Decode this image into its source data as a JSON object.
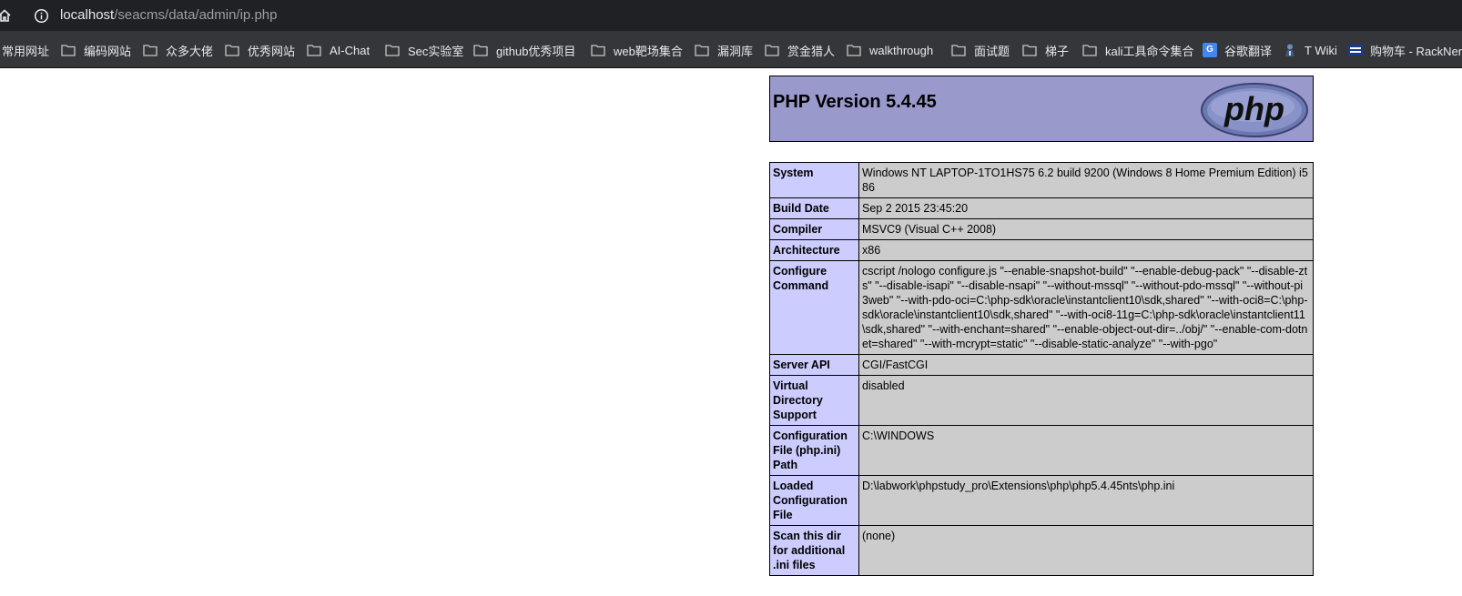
{
  "browser": {
    "url_host": "localhost",
    "url_path": "/seacms/data/admin/ip.php",
    "bookmarks": [
      {
        "label": "常用网址",
        "icon": "folder-icon"
      },
      {
        "label": "编码网站",
        "icon": "folder-icon"
      },
      {
        "label": "众多大佬",
        "icon": "folder-icon"
      },
      {
        "label": "优秀网站",
        "icon": "folder-icon"
      },
      {
        "label": "AI-Chat",
        "icon": "folder-icon"
      },
      {
        "label": "Sec实验室",
        "icon": "folder-icon"
      },
      {
        "label": "github优秀项目",
        "icon": "folder-icon"
      },
      {
        "label": "web靶场集合",
        "icon": "folder-icon"
      },
      {
        "label": "漏洞库",
        "icon": "folder-icon"
      },
      {
        "label": "赏金猎人",
        "icon": "folder-icon"
      },
      {
        "label": "walkthrough",
        "icon": "folder-icon"
      },
      {
        "label": "面试题",
        "icon": "folder-icon"
      },
      {
        "label": "梯子",
        "icon": "folder-icon"
      },
      {
        "label": "kali工具命令集合",
        "icon": "folder-icon"
      },
      {
        "label": "谷歌翻译",
        "icon": "google-translate-icon"
      },
      {
        "label": "T Wiki",
        "icon": "wiki-icon"
      },
      {
        "label": "购物车 - RackNerd",
        "icon": "racknerd-icon"
      }
    ]
  },
  "phpinfo": {
    "title": "PHP Version 5.4.45",
    "logo_text": "php",
    "rows": [
      {
        "key": "System",
        "value": "Windows NT LAPTOP-1TO1HS75 6.2 build 9200 (Windows 8 Home Premium Edition) i586"
      },
      {
        "key": "Build Date",
        "value": "Sep 2 2015 23:45:20"
      },
      {
        "key": "Compiler",
        "value": "MSVC9 (Visual C++ 2008)"
      },
      {
        "key": "Architecture",
        "value": "x86"
      },
      {
        "key": "Configure Command",
        "value": "cscript /nologo configure.js \"--enable-snapshot-build\" \"--enable-debug-pack\" \"--disable-zts\" \"--disable-isapi\" \"--disable-nsapi\" \"--without-mssql\" \"--without-pdo-mssql\" \"--without-pi3web\" \"--with-pdo-oci=C:\\php-sdk\\oracle\\instantclient10\\sdk,shared\" \"--with-oci8=C:\\php-sdk\\oracle\\instantclient10\\sdk,shared\" \"--with-oci8-11g=C:\\php-sdk\\oracle\\instantclient11\\sdk,shared\" \"--with-enchant=shared\" \"--enable-object-out-dir=../obj/\" \"--enable-com-dotnet=shared\" \"--with-mcrypt=static\" \"--disable-static-analyze\" \"--with-pgo\""
      },
      {
        "key": "Server API",
        "value": "CGI/FastCGI"
      },
      {
        "key": "Virtual Directory Support",
        "value": "disabled"
      },
      {
        "key": "Configuration File (php.ini) Path",
        "value": "C:\\WINDOWS"
      },
      {
        "key": "Loaded Configuration File",
        "value": "D:\\labwork\\phpstudy_pro\\Extensions\\php\\php5.4.45nts\\php.ini"
      },
      {
        "key": "Scan this dir for additional .ini files",
        "value": "(none)"
      }
    ]
  }
}
